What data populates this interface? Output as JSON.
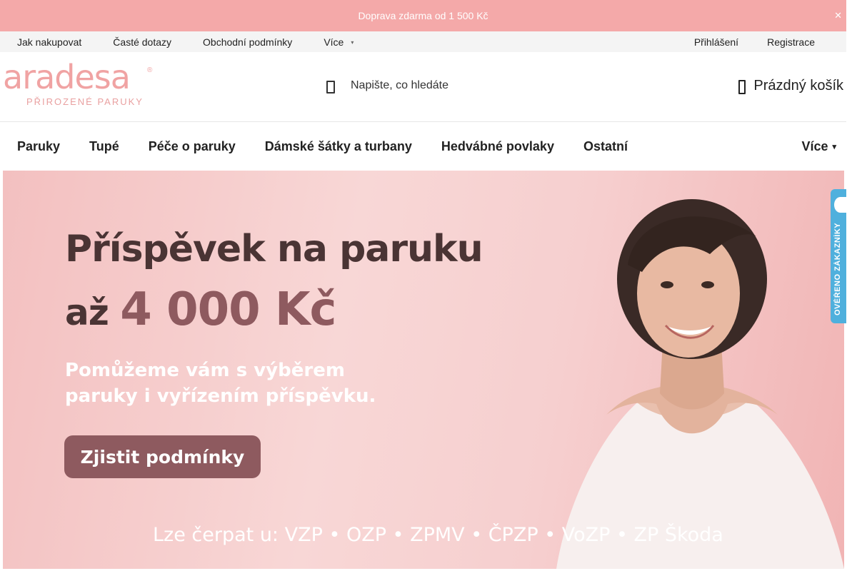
{
  "topbar": {
    "announcement": "Doprava zdarma od 1 500 Kč",
    "close_icon": "close-icon"
  },
  "utility": {
    "links": [
      "Jak nakupovat",
      "Časté dotazy",
      "Obchodní podmínky"
    ],
    "more_label": "Více",
    "login_label": "Přihlášení",
    "register_label": "Registrace"
  },
  "header": {
    "logo_word": "aradesa",
    "logo_reg": "®",
    "logo_tagline": "PŘIROZENÉ PARUKY",
    "search_placeholder": "Napište, co hledáte",
    "cart_label": "Prázdný košík"
  },
  "nav": {
    "items": [
      "Paruky",
      "Tupé",
      "Péče o paruky",
      "Dámské šátky a turbany",
      "Hedvábné povlaky",
      "Ostatní"
    ],
    "more_label": "Více"
  },
  "hero": {
    "title": "Příspěvek na paruku",
    "amount_prefix": "až ",
    "amount_value": "4 000 Kč",
    "subtitle_line1": "Pomůžeme vám s výběrem",
    "subtitle_line2": "paruky i vyřízením příspěvku.",
    "cta_label": "Zjistit podmínky",
    "insurers": "Lze čerpat u: VZP • OZP • ZPMV • ČPZP • VoZP • ZP Škoda"
  },
  "badge": {
    "label": "OVĚŘENO ZÁKAZNÍKY"
  },
  "colors": {
    "brand_pink": "#f4a9a9",
    "cta": "#8e5a5f",
    "badge_blue": "#4fb0dd"
  }
}
